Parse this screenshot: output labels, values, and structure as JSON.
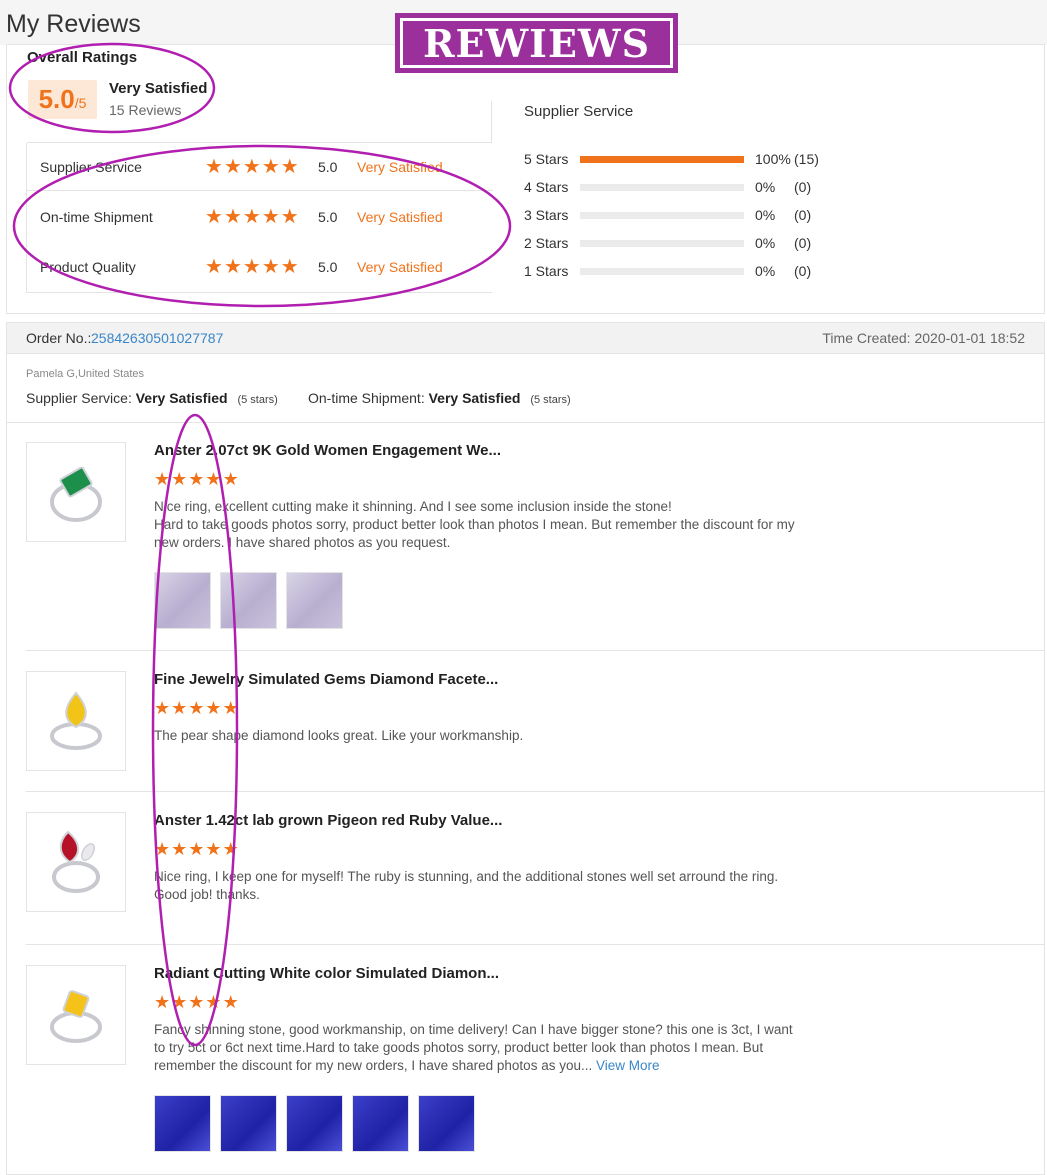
{
  "header": {
    "title": "My Reviews",
    "banner": "REWIEWS"
  },
  "overall": {
    "title": "Overall Ratings",
    "score": "5.0",
    "score_max": "/5",
    "label": "Very Satisfied",
    "count": "15 Reviews"
  },
  "criteria": [
    {
      "label": "Supplier Service",
      "score": "5.0",
      "status": "Very Satisfied",
      "stars": 5
    },
    {
      "label": "On-time Shipment",
      "score": "5.0",
      "status": "Very Satisfied",
      "stars": 5
    },
    {
      "label": "Product Quality",
      "score": "5.0",
      "status": "Very Satisfied",
      "stars": 5
    }
  ],
  "distribution": {
    "title": "Supplier Service",
    "rows": [
      {
        "label": "5 Stars",
        "fraction": 1.0,
        "pct": "100%",
        "count": "(15)"
      },
      {
        "label": "4 Stars",
        "fraction": 0.0,
        "pct": "0%",
        "count": "(0)"
      },
      {
        "label": "3 Stars",
        "fraction": 0.0,
        "pct": "0%",
        "count": "(0)"
      },
      {
        "label": "2 Stars",
        "fraction": 0.0,
        "pct": "0%",
        "count": "(0)"
      },
      {
        "label": "1 Stars",
        "fraction": 0.0,
        "pct": "0%",
        "count": "(0)"
      }
    ]
  },
  "order": {
    "no_label": "Order No.:",
    "no_value": "25842630501027787",
    "time_created": "Time Created: 2020-01-01 18:52",
    "reviewer": "Pamela G,United States",
    "supplier_service_label": "Supplier Service:",
    "supplier_service_value": "Very Satisfied",
    "supplier_service_hint": "(5 stars)",
    "shipment_label": "On-time Shipment:",
    "shipment_value": "Very Satisfied",
    "shipment_hint": "(5 stars)"
  },
  "items": [
    {
      "title": "Anster 2.07ct 9K Gold Women Engagement We...",
      "stars": 5,
      "text": "Nice ring, excellent cutting make it shinning. And I see some inclusion inside the stone!\nHard to take goods photos sorry, product better look than photos I mean. But remember the discount for my new orders. I have shared photos as you request.",
      "gem_color": "#1c8f4a",
      "photos": [
        "lav",
        "lav",
        "lav"
      ]
    },
    {
      "title": "Fine Jewelry Simulated Gems Diamond Facete...",
      "stars": 5,
      "text": "The pear shape diamond looks great. Like your workmanship.",
      "gem_color": "#f2c418",
      "photos": []
    },
    {
      "title": "Anster 1.42ct lab grown Pigeon red Ruby Value...",
      "stars": 5,
      "text": "Nice ring, I keep one for myself! The ruby is stunning, and the additional stones well set arround the ring. Good job! thanks.",
      "gem_color": "#b5122a",
      "photos": []
    },
    {
      "title": "Radiant Cutting White color Simulated Diamon...",
      "stars": 5,
      "text": "Fancy shinning stone, good workmanship, on time delivery! Can I have bigger stone? this one is 3ct, I want to try 5ct or 6ct next time.Hard to take goods photos sorry, product better look than photos I mean. But remember the discount for my new orders, I have shared photos as you...",
      "more": "View More",
      "gem_color": "#f5c21a",
      "photos": [
        "blue",
        "blue",
        "blue",
        "blue",
        "blue"
      ]
    }
  ],
  "colors": {
    "accent": "#f0731b",
    "link": "#3a86c8",
    "highlight": "#b01fb0"
  }
}
